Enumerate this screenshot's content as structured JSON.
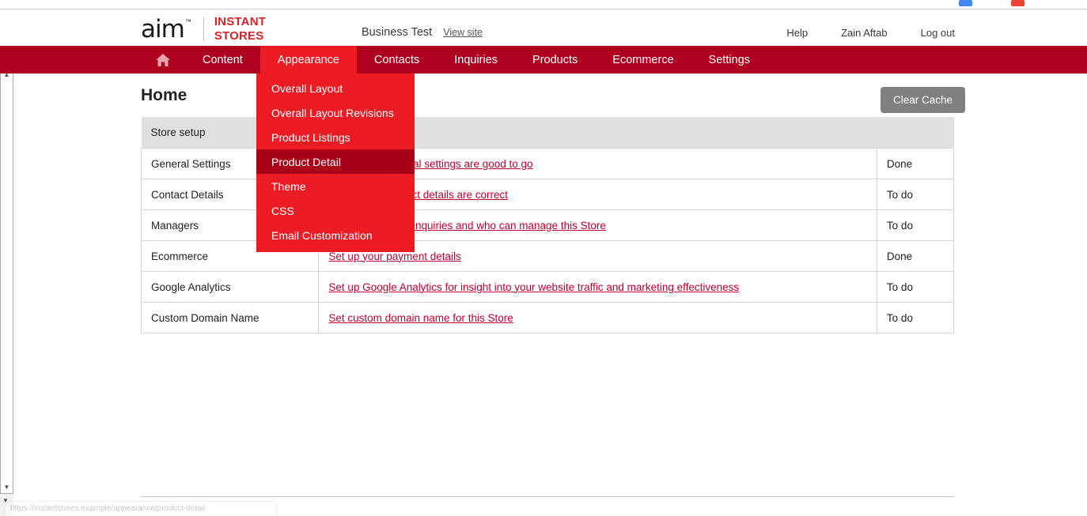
{
  "browser": {
    "bookmark_colors": [
      "#4285f4",
      "#ea4335"
    ],
    "status_url": "https://instantstores.example/appearance/product-detail"
  },
  "header": {
    "logo_primary": "aim",
    "logo_tm": "™",
    "logo_secondary_line1": "INSTANT",
    "logo_secondary_line2": "STORES",
    "business_name": "Business Test",
    "view_site_label": "View site",
    "links": [
      {
        "label": "Help",
        "name": "help-link"
      },
      {
        "label": "Zain Aftab",
        "name": "account-link"
      },
      {
        "label": "Log out",
        "name": "logout-link"
      }
    ]
  },
  "nav": {
    "home_icon": "home-icon",
    "items": [
      {
        "label": "Content",
        "active": false
      },
      {
        "label": "Appearance",
        "active": true
      },
      {
        "label": "Contacts",
        "active": false
      },
      {
        "label": "Inquiries",
        "active": false
      },
      {
        "label": "Products",
        "active": false
      },
      {
        "label": "Ecommerce",
        "active": false
      },
      {
        "label": "Settings",
        "active": false
      }
    ]
  },
  "dropdown": {
    "open_for": "Appearance",
    "items": [
      {
        "label": "Overall Layout",
        "hover": false
      },
      {
        "label": "Overall Layout Revisions",
        "hover": false
      },
      {
        "label": "Product Listings",
        "hover": false
      },
      {
        "label": "Product Detail",
        "hover": true
      },
      {
        "label": "Theme",
        "hover": false
      },
      {
        "label": "CSS",
        "hover": false
      },
      {
        "label": "Email Customization",
        "hover": false
      }
    ]
  },
  "main": {
    "page_title": "Home",
    "clear_cache_label": "Clear Cache",
    "table": {
      "headers": [
        "Store setup",
        "",
        ""
      ],
      "rows": [
        {
          "name": "General Settings",
          "link": "Check your general settings are good to go",
          "status": "Done"
        },
        {
          "name": "Contact Details",
          "link": "Check your contact details are correct",
          "status": "To do"
        },
        {
          "name": "Managers",
          "link": "Set who receives inquiries and who can manage this Store",
          "status": "To do"
        },
        {
          "name": "Ecommerce",
          "link": "Set up your payment details",
          "status": "Done"
        },
        {
          "name": "Google Analytics",
          "link": "Set up Google Analytics for insight into your website traffic and marketing effectiveness",
          "status": "To do"
        },
        {
          "name": "Custom Domain Name",
          "link": "Set custom domain name for this Store",
          "status": "To do"
        }
      ]
    }
  },
  "colors": {
    "nav_bar": "#b0001f",
    "nav_active": "#ed1c24",
    "dropdown_bg": "#ed1c24",
    "dropdown_hover": "#a90017",
    "link_red": "#c2002f",
    "button_gray": "#808080",
    "table_header_bg": "#e0e0e0"
  }
}
